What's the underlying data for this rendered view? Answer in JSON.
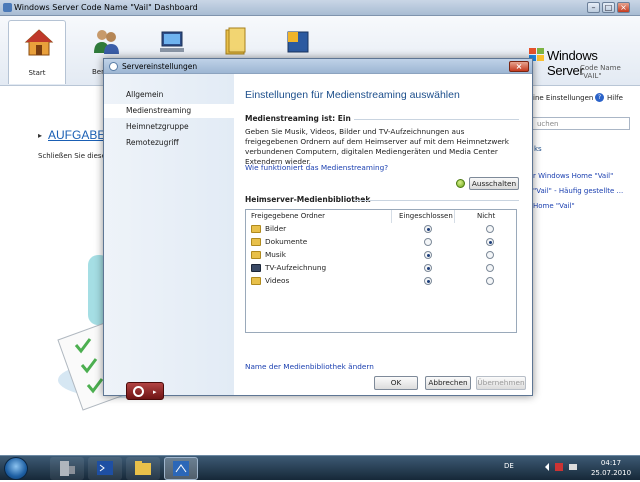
{
  "window": {
    "title": "Windows Server Code Name \"Vail\" Dashboard"
  },
  "ribbon": {
    "tabs": [
      {
        "label": "Start",
        "icon": "home-icon"
      },
      {
        "label": "Ben",
        "icon": "users-icon"
      },
      {
        "label": "",
        "icon": "computer-icon"
      },
      {
        "label": "",
        "icon": "folder-icon"
      },
      {
        "label": "",
        "icon": "addins-icon"
      }
    ],
    "logo": {
      "line1": "Windows Server",
      "line2": "Code Name \"VAIL\""
    }
  },
  "background": {
    "aufgaben_title": "AUFGABEN",
    "schliessen_text": "Schließen Sie diese A",
    "right": {
      "settings_link": "ine Einstellungen",
      "help_link": "Hilfe",
      "search_placeholder": "uchen",
      "section_links": "ks",
      "link1": "r Windows Home \"Vail\"",
      "link2": "\"Vail\" - Häufig gestellte ...",
      "link3": "Home \"Vail\""
    }
  },
  "dialog": {
    "title": "Servereinstellungen",
    "nav": [
      {
        "label": "Allgemein",
        "selected": false
      },
      {
        "label": "Medienstreaming",
        "selected": true
      },
      {
        "label": "Heimnetzgruppe",
        "selected": false
      },
      {
        "label": "Remotezugriff",
        "selected": false
      }
    ],
    "heading": "Einstellungen für Medienstreaming auswählen",
    "status_header": "Medienstreaming ist: Ein",
    "description": "Geben Sie Musik, Videos, Bilder und TV-Aufzeichnungen aus freigegebenen Ordnern auf dem Heimserver auf mit dem Heimnetzwerk verbundenen Computern, digitalen Mediengeräten und Media Center Extendern wieder.",
    "how_link": "Wie funktioniert das Medienstreaming?",
    "toggle_button": "Ausschalten",
    "library_header": "Heimserver-Medienbibliothek",
    "table": {
      "columns": [
        "Freigegebene Ordner",
        "Eingeschlossen",
        "Nicht"
      ],
      "rows": [
        {
          "name": "Bilder",
          "included": true
        },
        {
          "name": "Dokumente",
          "included": false
        },
        {
          "name": "Musik",
          "included": true
        },
        {
          "name": "TV-Aufzeichnung",
          "included": true
        },
        {
          "name": "Videos",
          "included": true
        }
      ]
    },
    "rename_link": "Name der Medienbibliothek ändern",
    "buttons": {
      "ok": "OK",
      "cancel": "Abbrechen",
      "apply": "Übernehmen"
    }
  },
  "taskbar": {
    "lang": "DE",
    "time": "04:17",
    "date": "25.07.2010"
  }
}
